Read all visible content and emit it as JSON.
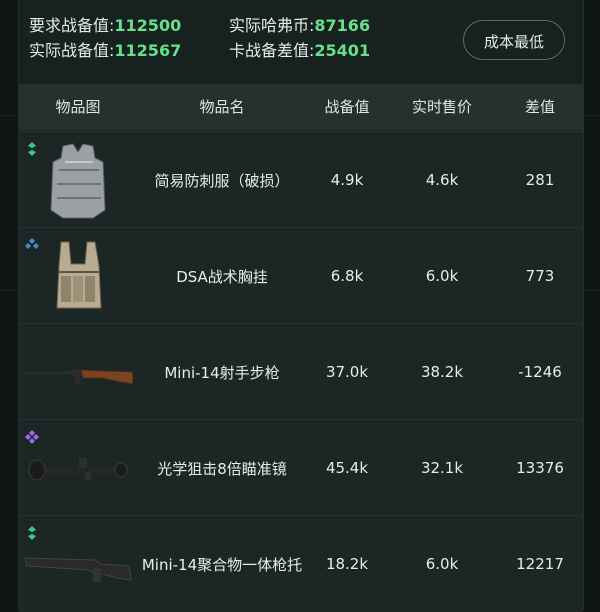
{
  "stats": {
    "required_label": "要求战备值:",
    "required_value": "112500",
    "actual_label": "实际战备值:",
    "actual_value": "112567",
    "haf_label": "实际哈弗币:",
    "haf_value": "87166",
    "diff_label": "卡战备差值:",
    "diff_value": "25401"
  },
  "cost_button": "成本最低",
  "columns": [
    "物品图",
    "物品名",
    "战备值",
    "实时售价",
    "差值"
  ],
  "rows": [
    {
      "icon": "vest-icon",
      "rarity": "green",
      "name": "简易防刺服（破损）",
      "value": "4.9k",
      "price": "4.6k",
      "diff": "281"
    },
    {
      "icon": "chest-rig-icon",
      "rarity": "blue",
      "name": "DSA战术胸挂",
      "value": "6.8k",
      "price": "6.0k",
      "diff": "773"
    },
    {
      "icon": "rifle-icon",
      "rarity": "none",
      "name": "Mini-14射手步枪",
      "value": "37.0k",
      "price": "38.2k",
      "diff": "-1246"
    },
    {
      "icon": "scope-icon",
      "rarity": "purple",
      "name": "光学狙击8倍瞄准镜",
      "value": "45.4k",
      "price": "32.1k",
      "diff": "13376"
    },
    {
      "icon": "stock-icon",
      "rarity": "green",
      "name": "Mini-14聚合物一体枪托",
      "value": "18.2k",
      "price": "6.0k",
      "diff": "12217"
    }
  ],
  "colors": {
    "accent_green": "#67e08a",
    "rarity_green": "#35c79a",
    "rarity_blue": "#3f8de0",
    "rarity_purple": "#9a6bf0"
  }
}
